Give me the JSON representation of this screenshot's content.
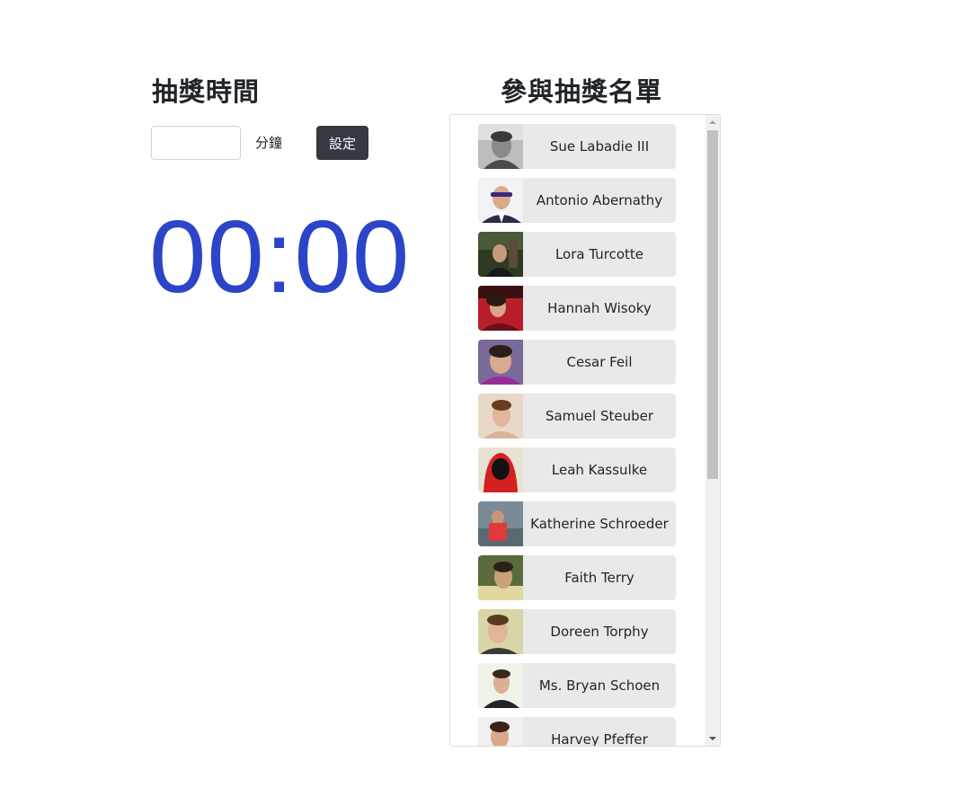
{
  "timer": {
    "title": "抽獎時間",
    "minutes_value": "",
    "minutes_placeholder": "",
    "unit_label": "分鐘",
    "set_button_label": "設定",
    "countdown": "00:00",
    "countdown_color": "#2b44c8"
  },
  "participants": {
    "title": "參與抽獎名單",
    "items": [
      {
        "name": "Sue Labadie III",
        "avatar": "avatar-photo"
      },
      {
        "name": "Antonio Abernathy",
        "avatar": "avatar-photo"
      },
      {
        "name": "Lora Turcotte",
        "avatar": "avatar-photo"
      },
      {
        "name": "Hannah Wisoky",
        "avatar": "avatar-photo"
      },
      {
        "name": "Cesar Feil",
        "avatar": "avatar-photo"
      },
      {
        "name": "Samuel Steuber",
        "avatar": "avatar-photo"
      },
      {
        "name": "Leah Kassulke",
        "avatar": "avatar-photo"
      },
      {
        "name": "Katherine Schroeder",
        "avatar": "avatar-photo"
      },
      {
        "name": "Faith Terry",
        "avatar": "avatar-photo"
      },
      {
        "name": "Doreen Torphy",
        "avatar": "avatar-photo"
      },
      {
        "name": "Ms. Bryan Schoen",
        "avatar": "avatar-photo"
      },
      {
        "name": "Harvey Pfeffer",
        "avatar": "avatar-photo"
      }
    ]
  },
  "colors": {
    "button_bg": "#343a40",
    "item_bg": "#e9e9e9"
  }
}
